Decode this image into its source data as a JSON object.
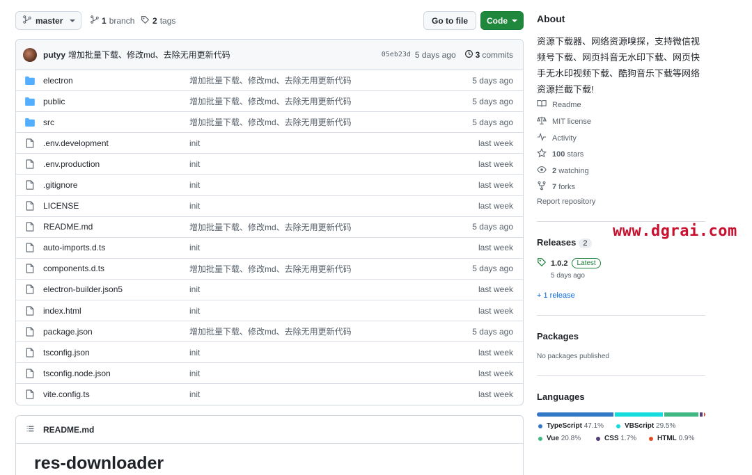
{
  "topbar": {
    "branch_name": "master",
    "branch_count": "1",
    "branch_label": "branch",
    "tag_count": "2",
    "tag_label": "tags",
    "goto_file": "Go to file",
    "code_label": "Code"
  },
  "commit": {
    "author": "putyy",
    "message": "增加批量下载、修改md、去除无用更新代码",
    "sha": "05eb23d",
    "age": "5 days ago",
    "count": "3",
    "count_label": "commits"
  },
  "files": [
    {
      "type": "folder",
      "name": "electron",
      "message": "增加批量下载、修改md、去除无用更新代码",
      "age": "5 days ago"
    },
    {
      "type": "folder",
      "name": "public",
      "message": "增加批量下载、修改md、去除无用更新代码",
      "age": "5 days ago"
    },
    {
      "type": "folder",
      "name": "src",
      "message": "增加批量下载、修改md、去除无用更新代码",
      "age": "5 days ago"
    },
    {
      "type": "file",
      "name": ".env.development",
      "message": "init",
      "age": "last week"
    },
    {
      "type": "file",
      "name": ".env.production",
      "message": "init",
      "age": "last week"
    },
    {
      "type": "file",
      "name": ".gitignore",
      "message": "init",
      "age": "last week"
    },
    {
      "type": "file",
      "name": "LICENSE",
      "message": "init",
      "age": "last week"
    },
    {
      "type": "file",
      "name": "README.md",
      "message": "增加批量下载、修改md、去除无用更新代码",
      "age": "5 days ago"
    },
    {
      "type": "file",
      "name": "auto-imports.d.ts",
      "message": "init",
      "age": "last week"
    },
    {
      "type": "file",
      "name": "components.d.ts",
      "message": "增加批量下载、修改md、去除无用更新代码",
      "age": "5 days ago"
    },
    {
      "type": "file",
      "name": "electron-builder.json5",
      "message": "init",
      "age": "last week"
    },
    {
      "type": "file",
      "name": "index.html",
      "message": "init",
      "age": "last week"
    },
    {
      "type": "file",
      "name": "package.json",
      "message": "增加批量下载、修改md、去除无用更新代码",
      "age": "5 days ago"
    },
    {
      "type": "file",
      "name": "tsconfig.json",
      "message": "init",
      "age": "last week"
    },
    {
      "type": "file",
      "name": "tsconfig.node.json",
      "message": "init",
      "age": "last week"
    },
    {
      "type": "file",
      "name": "vite.config.ts",
      "message": "init",
      "age": "last week"
    }
  ],
  "readme": {
    "filename": "README.md",
    "title": "res-downloader"
  },
  "about": {
    "heading": "About",
    "description": "资源下载器、网络资源嗅探，支持微信视频号下载、网页抖音无水印下载、网页快手无水印视频下载、酷狗音乐下载等网络资源拦截下载!",
    "readme": "Readme",
    "license": "MIT license",
    "activity": "Activity",
    "stars_count": "100",
    "stars_label": "stars",
    "watching_count": "2",
    "watching_label": "watching",
    "forks_count": "7",
    "forks_label": "forks",
    "report": "Report repository"
  },
  "releases": {
    "heading": "Releases",
    "count": "2",
    "version": "1.0.2",
    "latest_badge": "Latest",
    "date": "5 days ago",
    "more": "+ 1 release"
  },
  "packages": {
    "heading": "Packages",
    "empty": "No packages published"
  },
  "languages": {
    "heading": "Languages",
    "items": [
      {
        "name": "TypeScript",
        "percent": "47.1%",
        "value": 47.1,
        "color": "#3178c6"
      },
      {
        "name": "VBScript",
        "percent": "29.5%",
        "value": 29.5,
        "color": "#15dcdc"
      },
      {
        "name": "Vue",
        "percent": "20.8%",
        "value": 20.8,
        "color": "#41b883"
      },
      {
        "name": "CSS",
        "percent": "1.7%",
        "value": 1.7,
        "color": "#563d7c"
      },
      {
        "name": "HTML",
        "percent": "0.9%",
        "value": 0.9,
        "color": "#e34c26"
      }
    ]
  },
  "watermark": "www.dgrai.com",
  "colors": {
    "folder": "#54aeff",
    "green_button": "#1f883d",
    "link": "#0969da"
  }
}
